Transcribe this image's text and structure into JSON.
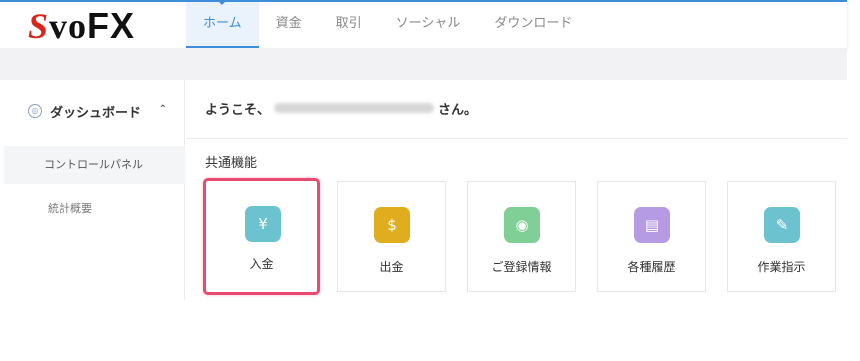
{
  "header": {
    "logo_s": "S",
    "logo_vo": "vo",
    "logo_fx": "FX",
    "nav": [
      {
        "label": "ホーム",
        "active": true
      },
      {
        "label": "資金",
        "active": false
      },
      {
        "label": "取引",
        "active": false
      },
      {
        "label": "ソーシャル",
        "active": false
      },
      {
        "label": "ダウンロード",
        "active": false
      }
    ]
  },
  "sidebar": {
    "dashboard_label": "ダッシュボード",
    "items": [
      {
        "label": "コントロールパネル",
        "active": true
      },
      {
        "label": "統計概要",
        "active": false
      }
    ]
  },
  "main": {
    "welcome_prefix": "ようこそ、",
    "welcome_suffix": "さん。",
    "section_title": "共通機能",
    "cards": [
      {
        "label": "入金",
        "icon": "deposit-icon",
        "color": "#6cc3cf"
      },
      {
        "label": "出金",
        "icon": "withdraw-icon",
        "color": "#e0ad1e"
      },
      {
        "label": "ご登録情報",
        "icon": "profile-icon",
        "color": "#7fcf97"
      },
      {
        "label": "各種履歴",
        "icon": "history-icon",
        "color": "#b49be3"
      },
      {
        "label": "作業指示",
        "icon": "task-icon",
        "color": "#6cc3cf"
      }
    ]
  },
  "colors": {
    "accent": "#3f8fd8",
    "highlight": "#e84a72"
  }
}
